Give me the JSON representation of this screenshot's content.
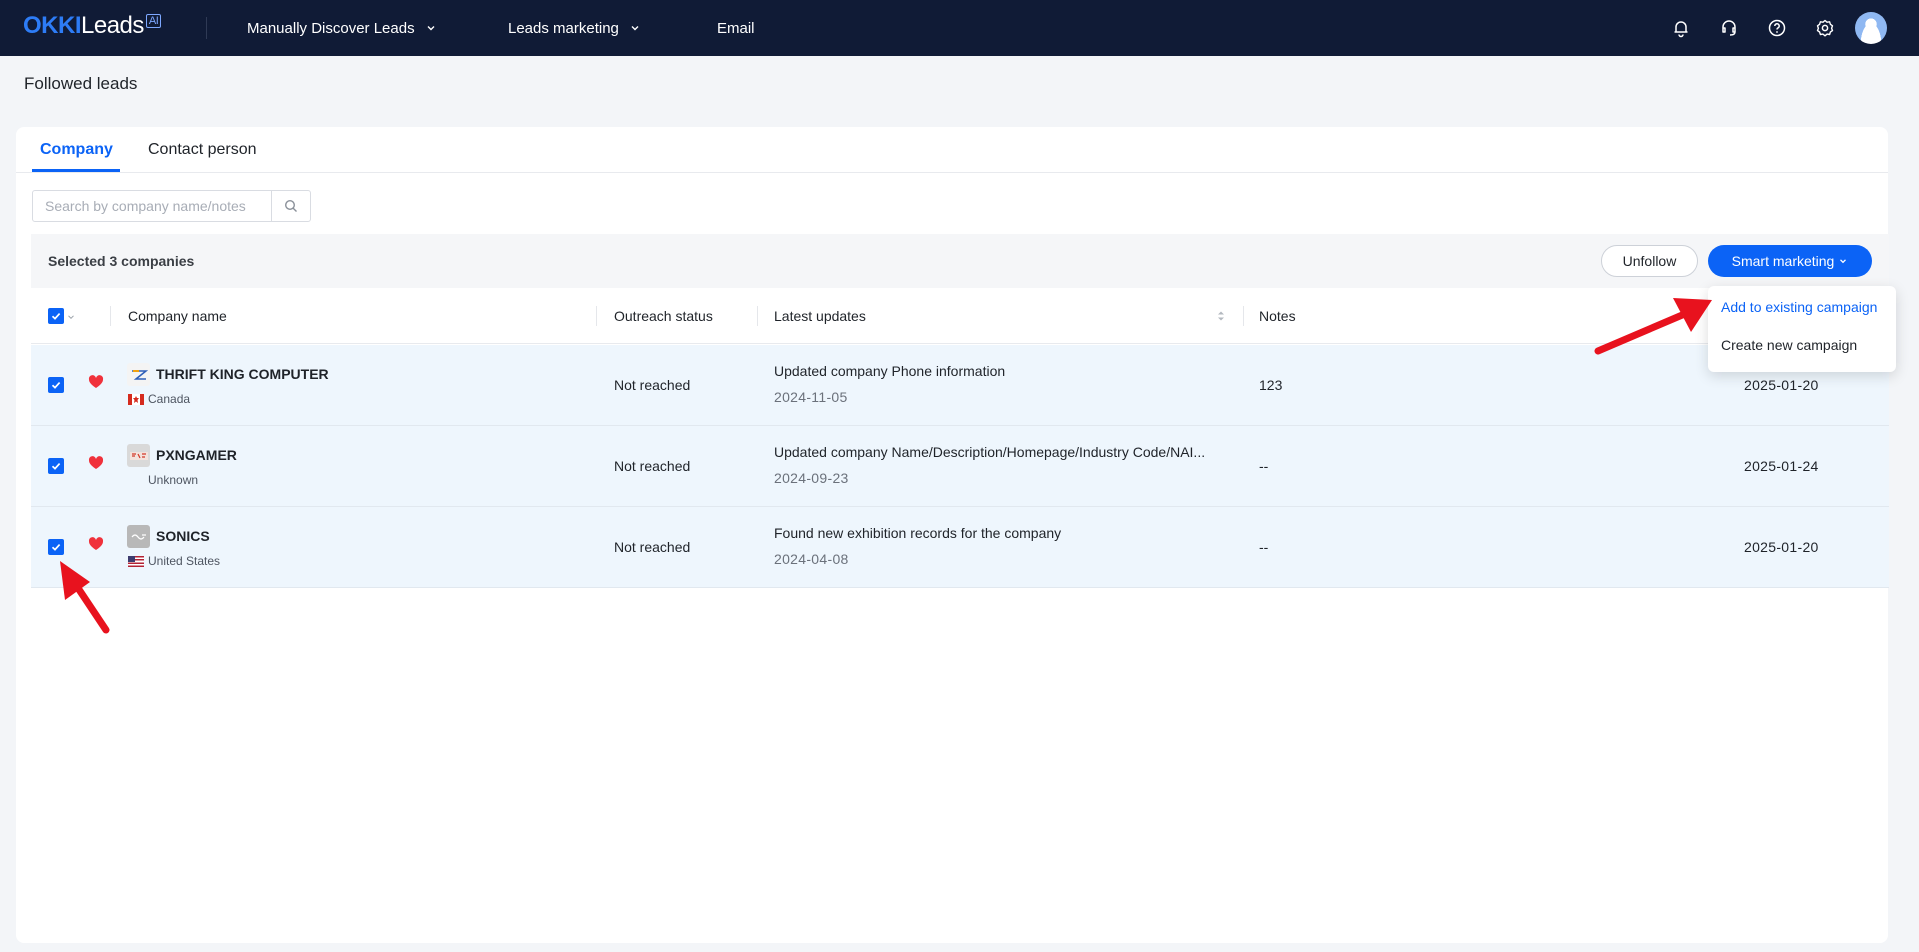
{
  "topbar": {
    "logo_okki": "OKKI",
    "logo_leads": "Leads",
    "logo_ai": "AI",
    "nav": [
      {
        "label": "Manually Discover Leads"
      },
      {
        "label": "Leads marketing"
      },
      {
        "label": "Email"
      }
    ],
    "icons": [
      "bell-icon",
      "headset-icon",
      "help-icon",
      "gear-icon",
      "avatar"
    ]
  },
  "page": {
    "title": "Followed leads"
  },
  "tabs": [
    {
      "label": "Company",
      "active": true
    },
    {
      "label": "Contact person",
      "active": false
    }
  ],
  "search": {
    "placeholder": "Search by company name/notes",
    "value": ""
  },
  "selection": {
    "text": "Selected 3 companies",
    "unfollow_label": "Unfollow",
    "smart_marketing_label": "Smart marketing"
  },
  "table": {
    "headers": {
      "company_name": "Company name",
      "outreach_status": "Outreach status",
      "latest_updates": "Latest updates",
      "notes": "Notes"
    },
    "rows": [
      {
        "name": "THRIFT KING COMPUTER",
        "country": "Canada",
        "status": "Not reached",
        "update": "Updated company Phone information",
        "update_date": "2024-11-05",
        "notes": "123",
        "date": "2025-01-20"
      },
      {
        "name": "PXNGAMER",
        "country": "Unknown",
        "status": "Not reached",
        "update": "Updated company Name/Description/Homepage/Industry Code/NAI...",
        "update_date": "2024-09-23",
        "notes": "--",
        "date": "2025-01-24"
      },
      {
        "name": "SONICS",
        "country": "United States",
        "status": "Not reached",
        "update": "Found new exhibition records for the company",
        "update_date": "2024-04-08",
        "notes": "--",
        "date": "2025-01-20"
      }
    ]
  },
  "dropdown": {
    "items": [
      {
        "label": "Add to existing campaign",
        "highlighted": true
      },
      {
        "label": "Create new campaign",
        "highlighted": false
      }
    ]
  },
  "colors": {
    "nav_bg": "#101b36",
    "accent": "#0b63f6",
    "row_selected_bg": "#eef6fd",
    "heart": "#f0313b",
    "annotation_arrow": "#e8121e"
  }
}
